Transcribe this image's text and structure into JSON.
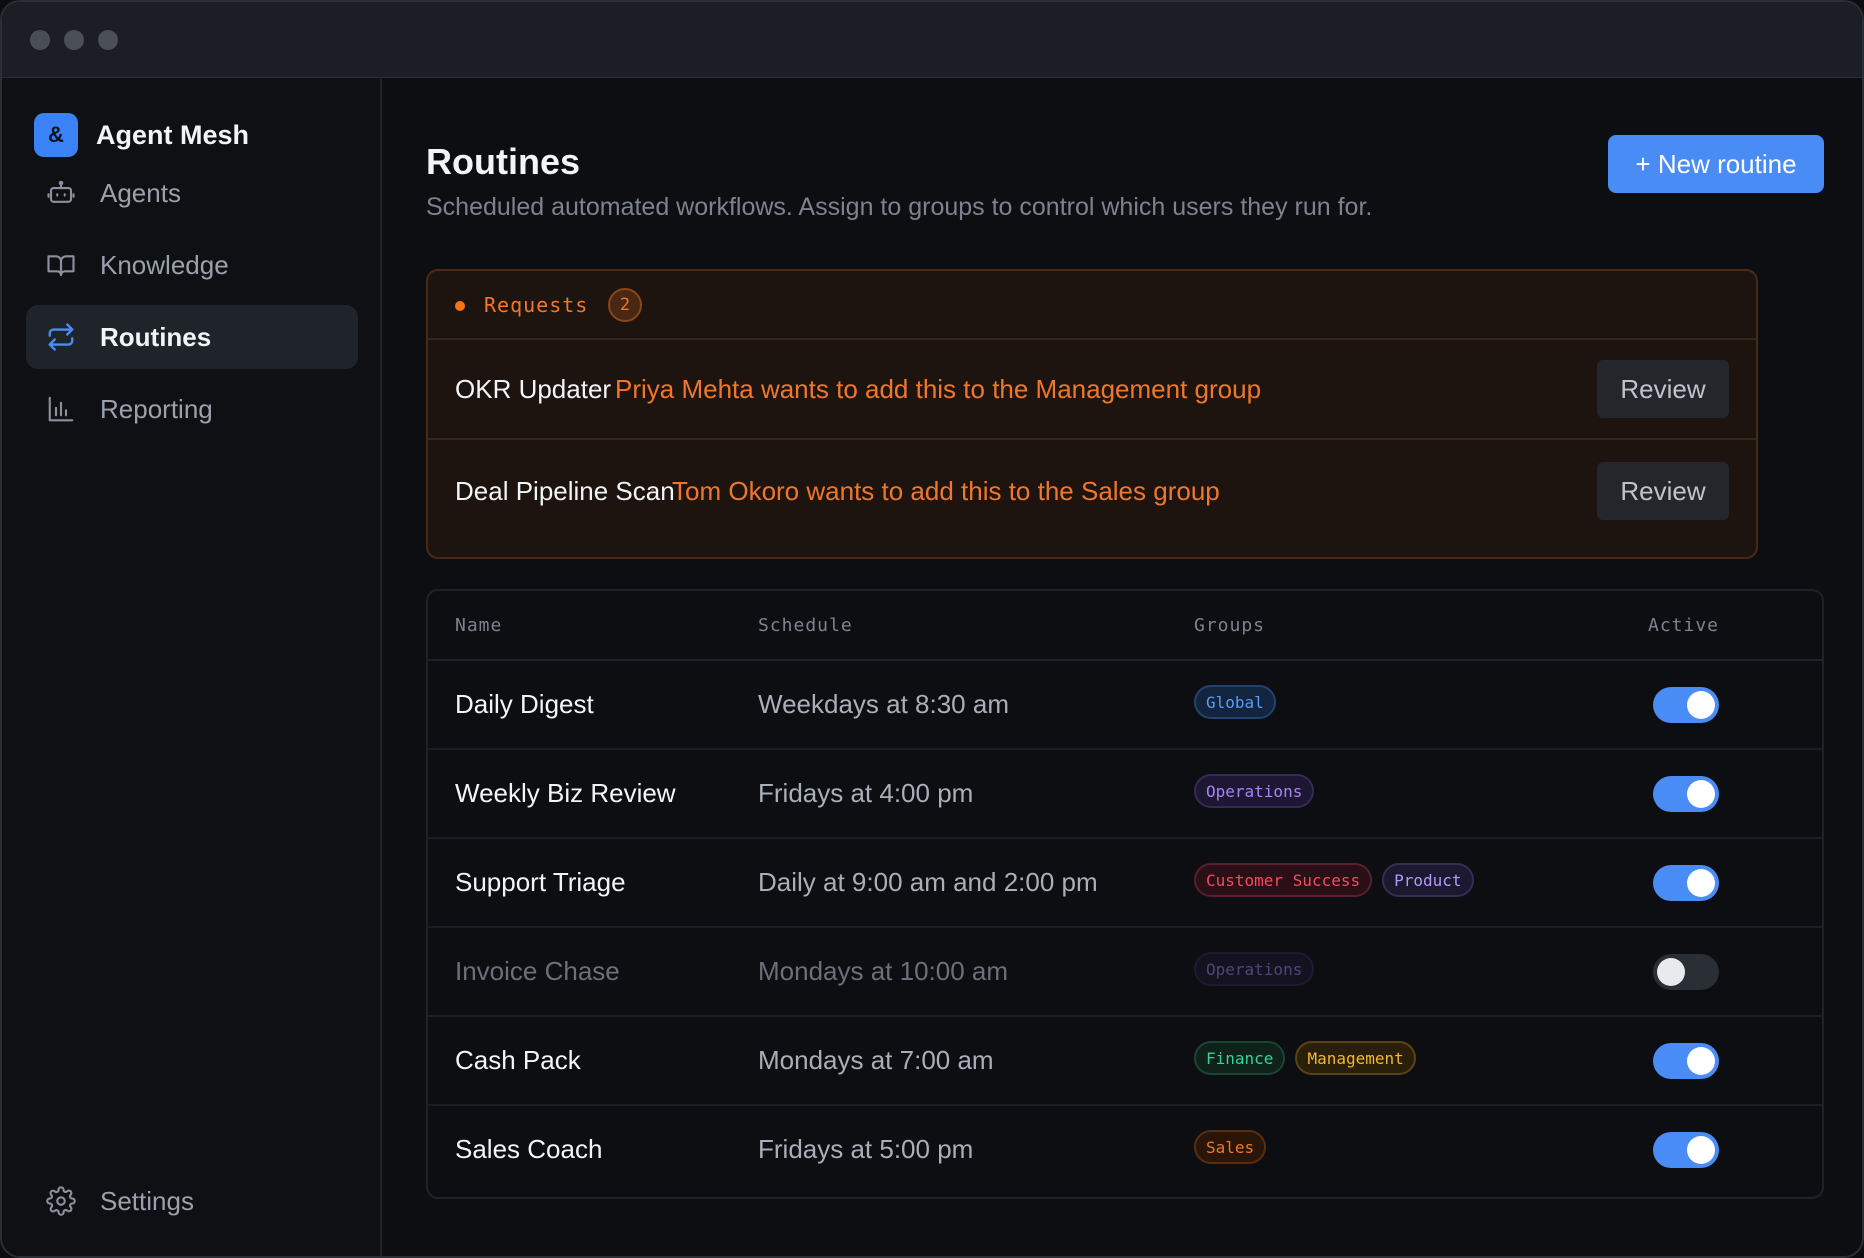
{
  "sidebar": {
    "brand": {
      "logo": "&",
      "name": "Agent Mesh"
    },
    "items": [
      {
        "label": "Agents",
        "icon": "robot-icon",
        "active": false
      },
      {
        "label": "Knowledge",
        "icon": "book-icon",
        "active": false
      },
      {
        "label": "Routines",
        "icon": "repeat-icon",
        "active": true
      },
      {
        "label": "Reporting",
        "icon": "bar-chart-icon",
        "active": false
      }
    ],
    "settings": {
      "label": "Settings",
      "icon": "gear-icon"
    }
  },
  "header": {
    "title": "Routines",
    "subtitle": "Scheduled automated workflows. Assign to groups to control which users they run for.",
    "new_button": "+ New routine"
  },
  "requests": {
    "title": "Requests",
    "count": "2",
    "items": [
      {
        "name": "OKR Updater",
        "separator": "·",
        "message": "Priya Mehta wants to add this to the Management group",
        "action": "Review"
      },
      {
        "name": "Deal Pipeline Scan",
        "separator": "·",
        "message": "Tom Okoro wants to add this to the Sales group",
        "action": "Review"
      }
    ]
  },
  "table": {
    "columns": [
      "Name",
      "Schedule",
      "Groups",
      "Active"
    ],
    "rows": [
      {
        "name": "Daily Digest",
        "schedule": "Weekdays at 8:30 am",
        "groups": [
          "Global"
        ],
        "active": true
      },
      {
        "name": "Weekly Biz Review",
        "schedule": "Fridays at 4:00 pm",
        "groups": [
          "Operations"
        ],
        "active": true
      },
      {
        "name": "Support Triage",
        "schedule": "Daily at 9:00 am and 2:00 pm",
        "groups": [
          "Customer Success",
          "Product"
        ],
        "active": true
      },
      {
        "name": "Invoice Chase",
        "schedule": "Mondays at 10:00 am",
        "groups": [
          "Operations"
        ],
        "active": false
      },
      {
        "name": "Cash Pack",
        "schedule": "Mondays at 7:00 am",
        "groups": [
          "Finance",
          "Management"
        ],
        "active": true
      },
      {
        "name": "Sales Coach",
        "schedule": "Fridays at 5:00 pm",
        "groups": [
          "Sales"
        ],
        "active": true
      }
    ]
  },
  "colors": {
    "accent": "#4a8cf5",
    "request": "#f0772a",
    "background": "#0c0e12"
  }
}
